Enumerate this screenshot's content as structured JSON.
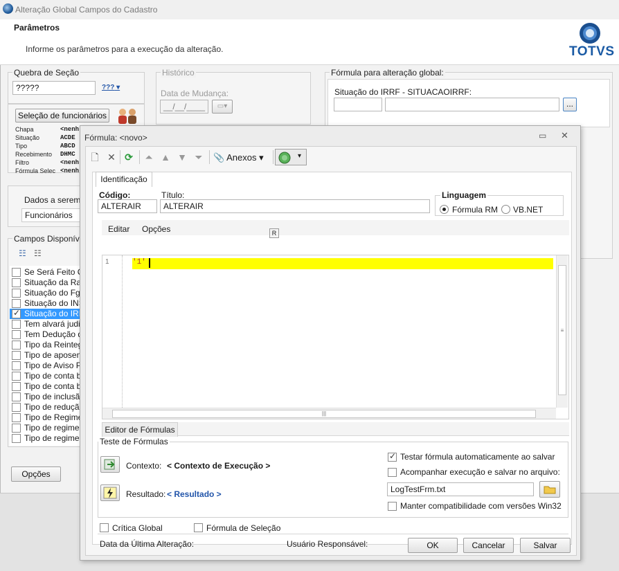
{
  "window": {
    "title": "Alteração Global Campos do Cadastro"
  },
  "header": {
    "title": "Parâmetros",
    "subtitle": "Informe os parâmetros para a execução da alteração.",
    "logo_text": "TOTVS"
  },
  "quebra": {
    "label": "Quebra de Seção",
    "value": "?????",
    "dropdown": "???"
  },
  "historico": {
    "label": "Histórico",
    "date_label": "Data de Mudança:",
    "date_value": "__/__/____"
  },
  "selecao": {
    "button": "Seleção de funcionários",
    "rows": [
      {
        "label": "Chapa",
        "value": "<nenh"
      },
      {
        "label": "Situação",
        "value": "ACDE"
      },
      {
        "label": "Tipo",
        "value": "ABCD"
      },
      {
        "label": "Recebimento",
        "value": "DHMC"
      },
      {
        "label": "Filtro",
        "value": "<nenh"
      },
      {
        "label": "Fórmula Selec",
        "value": "<nenh"
      }
    ]
  },
  "dados": {
    "label": "Dados a serem a",
    "value": "Funcionários"
  },
  "campos": {
    "label": "Campos Disponíveis",
    "items": [
      {
        "text": "Se Será Feito Co",
        "checked": false
      },
      {
        "text": "Situação da Rais",
        "checked": false
      },
      {
        "text": "Situação do Fgts",
        "checked": false
      },
      {
        "text": "Situação do INSS",
        "checked": false
      },
      {
        "text": "Situação do IRRF",
        "checked": true,
        "selected": true
      },
      {
        "text": "Tem alvará judici",
        "checked": false
      },
      {
        "text": "Tem Dedução de",
        "checked": false
      },
      {
        "text": "Tipo da Reintegra",
        "checked": false
      },
      {
        "text": "Tipo de aposenta",
        "checked": false
      },
      {
        "text": "Tipo de Aviso Pre",
        "checked": false
      },
      {
        "text": "Tipo de conta ba",
        "checked": false
      },
      {
        "text": "Tipo de conta ba",
        "checked": false
      },
      {
        "text": "Tipo de inclusão",
        "checked": false
      },
      {
        "text": "Tipo de redução",
        "checked": false
      },
      {
        "text": "Tipo de Regime c",
        "checked": false
      },
      {
        "text": "Tipo de regime pr",
        "checked": false
      },
      {
        "text": "Tipo de regime pr",
        "checked": false
      }
    ]
  },
  "formula_global": {
    "label": "Fórmula para alteração global:",
    "field_label": "Situação do IRRF - SITUACAOIRRF:",
    "browse": "..."
  },
  "opcoes_button": "Opções",
  "dialog": {
    "title": "Fórmula: <novo>",
    "toolbar": {
      "anexos": "Anexos"
    },
    "tab": "Identificação",
    "codigo_label": "Código:",
    "codigo_value": "ALTERAIR",
    "titulo_label": "Título:",
    "titulo_value": "ALTERAIR",
    "linguagem": {
      "label": "Linguagem",
      "opt1": "Fórmula RM",
      "opt2": "VB.NET",
      "selected": "Fórmula RM"
    },
    "editor_menu": {
      "editar": "Editar",
      "opcoes": "Opções",
      "badge": "R"
    },
    "editor": {
      "line_number": "1",
      "code": "'1'"
    },
    "editor_tab": "Editor de Fórmulas",
    "teste": {
      "label": "Teste de Fórmulas",
      "contexto_label": "Contexto:",
      "contexto_value": "< Contexto de Execução >",
      "resultado_label": "Resultado:",
      "resultado_value": "< Resultado >",
      "testar_auto": "Testar fórmula automaticamente ao salvar",
      "acompanhar": "Acompanhar execução e salvar no arquivo:",
      "file_value": "LogTestFrm.txt",
      "manter": "Manter compatibilidade com versões Win32"
    },
    "critica": "Crítica Global",
    "formula_selecao": "Fórmula de Seleção",
    "data_ultima": "Data da Última Alteração:",
    "usuario": "Usuário Responsável:",
    "buttons": {
      "ok": "OK",
      "cancelar": "Cancelar",
      "salvar": "Salvar"
    }
  }
}
